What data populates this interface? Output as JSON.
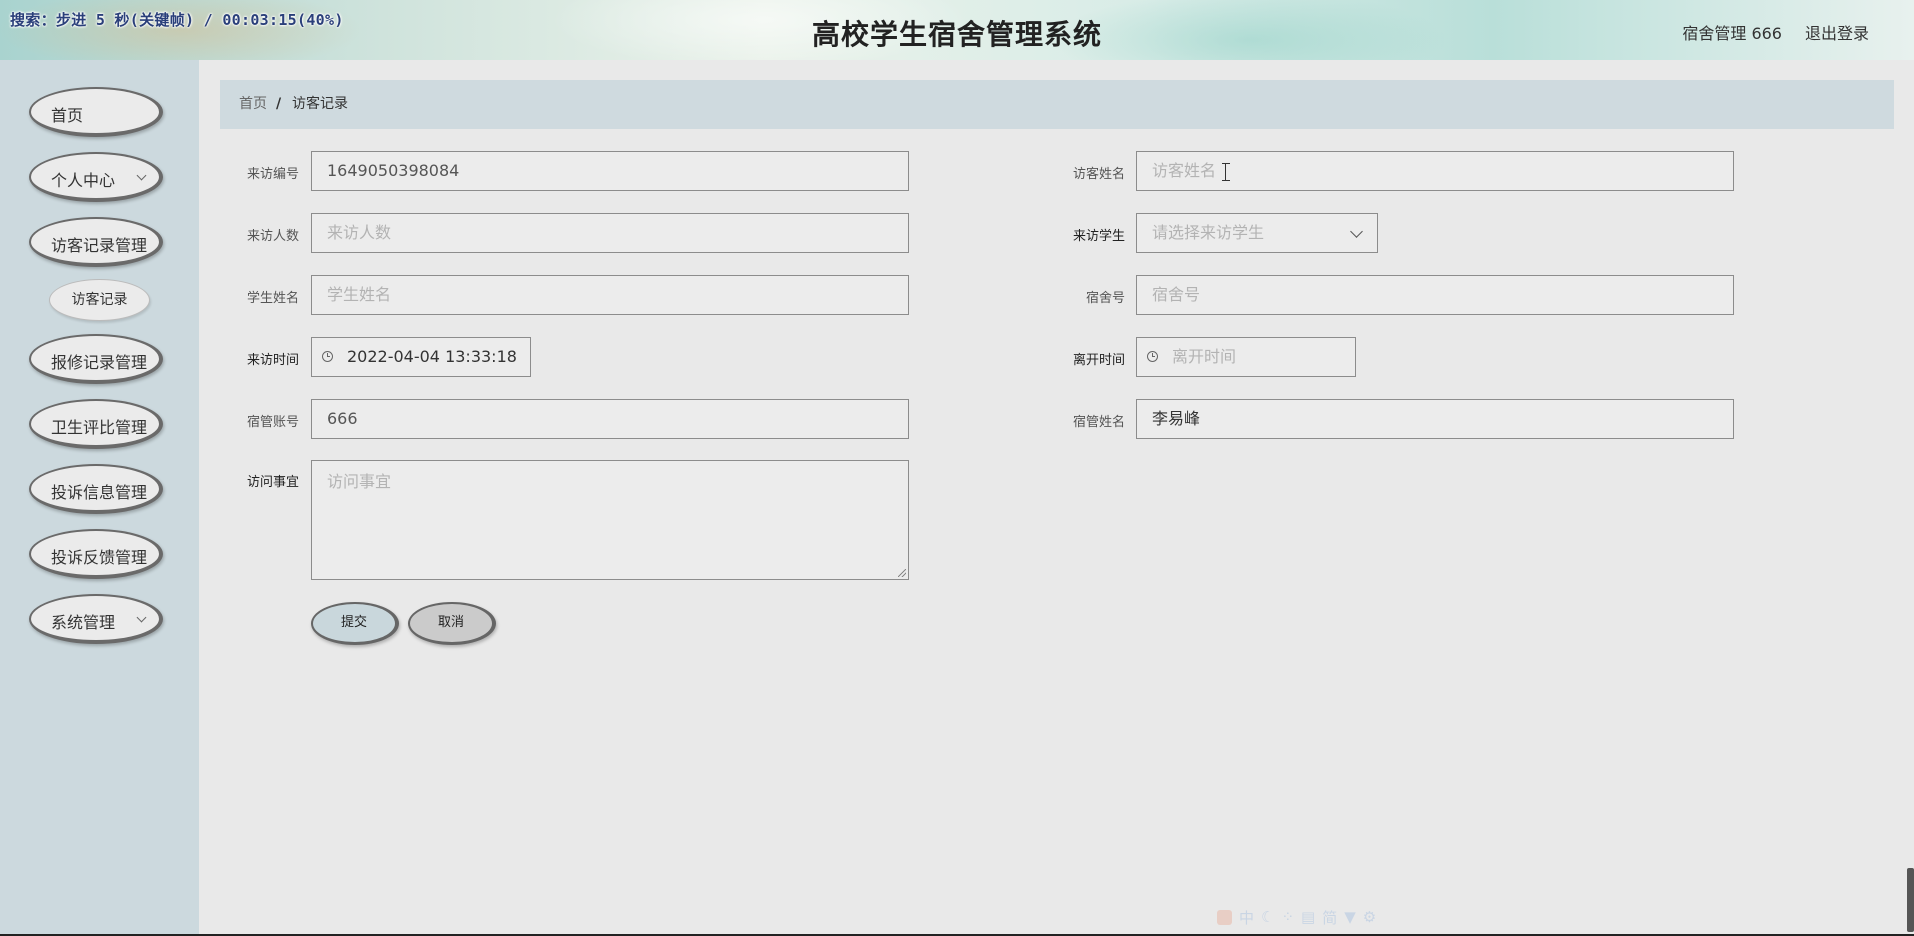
{
  "header": {
    "recording_status": "搜索：步进 5 秒(关键帧) / 00:03:15(40%)",
    "title": "高校学生宿舍管理系统",
    "user_info": "宿舍管理 666",
    "logout_label": "退出登录"
  },
  "sidebar": {
    "items": [
      {
        "label": "首页"
      },
      {
        "label": "个人中心"
      },
      {
        "label": "访客记录管理"
      },
      {
        "label": "访客记录"
      },
      {
        "label": "报修记录管理"
      },
      {
        "label": "卫生评比管理"
      },
      {
        "label": "投诉信息管理"
      },
      {
        "label": "投诉反馈管理"
      },
      {
        "label": "系统管理"
      }
    ]
  },
  "breadcrumb": {
    "home": "首页",
    "separator": "/",
    "current": "访客记录"
  },
  "form": {
    "visit_no": {
      "label": "来访编号",
      "value": "1649050398084"
    },
    "visitor_name": {
      "label": "访客姓名",
      "placeholder": "访客姓名"
    },
    "visitor_count": {
      "label": "来访人数",
      "placeholder": "来访人数"
    },
    "visited_student": {
      "label": "来访学生",
      "placeholder": "请选择来访学生"
    },
    "student_name": {
      "label": "学生姓名",
      "placeholder": "学生姓名"
    },
    "dorm_no": {
      "label": "宿舍号",
      "placeholder": "宿舍号"
    },
    "visit_time": {
      "label": "来访时间",
      "value": "2022-04-04 13:33:18"
    },
    "leave_time": {
      "label": "离开时间",
      "placeholder": "离开时间"
    },
    "manager_account": {
      "label": "宿管账号",
      "value": "666"
    },
    "manager_name": {
      "label": "宿管姓名",
      "value": "李易峰"
    },
    "visit_matter": {
      "label": "访问事宜",
      "placeholder": "访问事宜"
    }
  },
  "buttons": {
    "submit": "提交",
    "cancel": "取消"
  },
  "ime_toolbar": {
    "chars": [
      "中",
      "简"
    ]
  },
  "colors": {
    "sidebar_bg": "#ccd9de",
    "breadcrumb_bg": "#cfdadf",
    "page_bg": "#e9e9e9",
    "submit_bg": "#c9d7dc",
    "cancel_bg": "#cbcbcb"
  }
}
